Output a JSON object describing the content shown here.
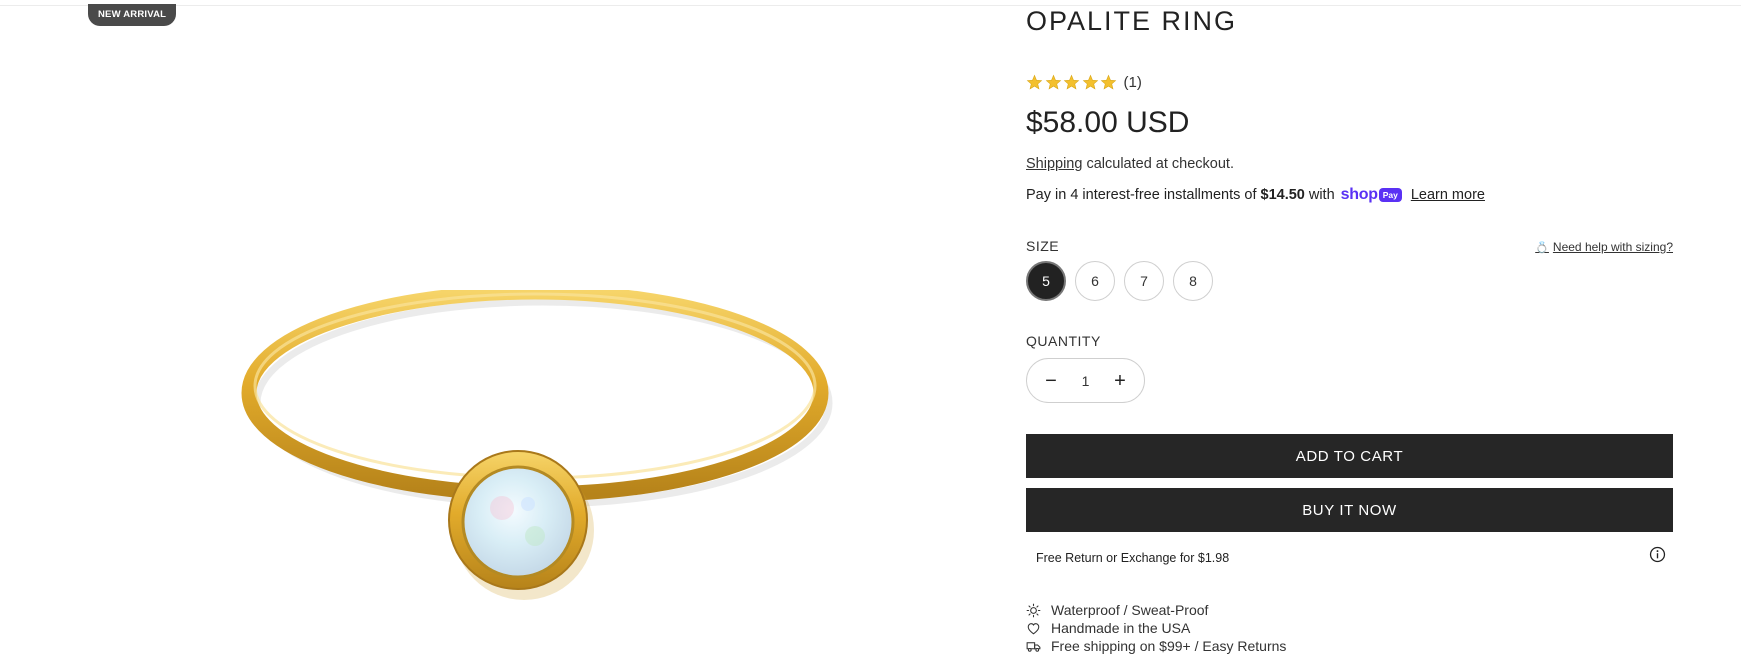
{
  "badge": {
    "label": "NEW ARRIVAL"
  },
  "product": {
    "title": "OPALITE RING",
    "rating": {
      "value": 5,
      "max": 5,
      "count_label": "(1)",
      "star_color": "#f3c02e"
    },
    "price": "$58.00 USD",
    "shipping": {
      "link": "Shipping",
      "suffix": "calculated at checkout."
    },
    "installments": {
      "prefix": "Pay in 4 interest-free installments of",
      "amount": "$14.50",
      "with": "with",
      "brand_shop": "shop",
      "brand_pay": "Pay",
      "learn_more": "Learn more",
      "brand_color": "#5a31f4"
    },
    "image_alt": "gold ring with white opal stone"
  },
  "size": {
    "label": "SIZE",
    "help": "Need help with sizing?",
    "options": [
      "5",
      "6",
      "7",
      "8"
    ],
    "selected": "5"
  },
  "quantity": {
    "label": "QUANTITY",
    "value": "1",
    "minus": "−",
    "plus": "+"
  },
  "actions": {
    "add_to_cart": "ADD TO CART",
    "buy_now": "BUY IT NOW"
  },
  "returns": {
    "text": "Free Return or Exchange for $1.98"
  },
  "features": [
    {
      "icon": "sun-icon",
      "text": "Waterproof / Sweat-Proof"
    },
    {
      "icon": "heart-icon",
      "text": "Handmade in the USA"
    },
    {
      "icon": "truck-icon",
      "text": "Free shipping on $99+ / Easy Returns"
    }
  ],
  "colors": {
    "button": "#262626",
    "selected_size": "#222222"
  }
}
